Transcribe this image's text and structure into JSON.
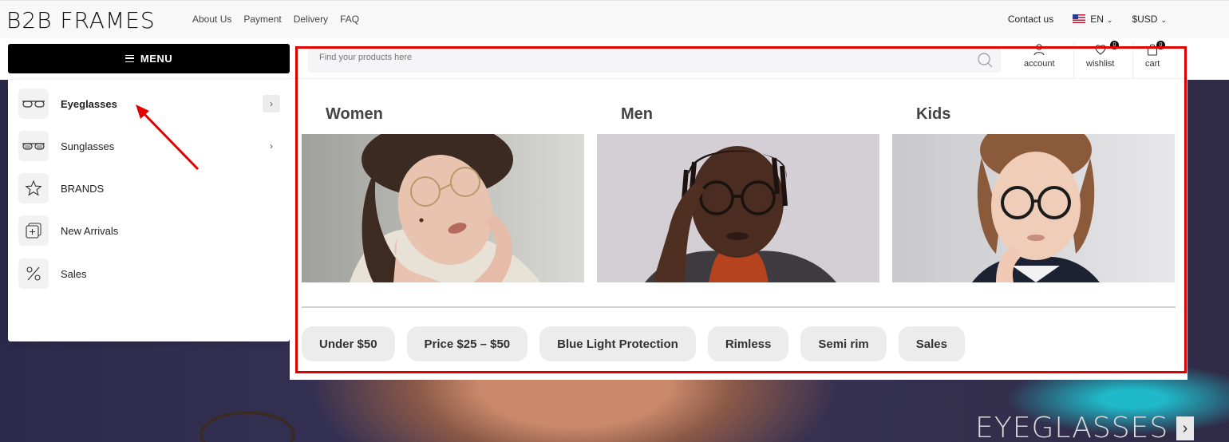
{
  "header": {
    "logo": "B2B FRAMES",
    "nav": [
      "About Us",
      "Payment",
      "Delivery",
      "FAQ"
    ],
    "contact": "Contact us",
    "language": "EN",
    "currency": "$USD"
  },
  "menu_button": {
    "label": "MENU"
  },
  "menu": {
    "items": [
      {
        "label": "Eyeglasses",
        "icon": "eyeglasses-icon",
        "has_submenu": true,
        "active": true
      },
      {
        "label": "Sunglasses",
        "icon": "sunglasses-icon",
        "has_submenu": true,
        "active": false
      },
      {
        "label": "BRANDS",
        "icon": "star-icon",
        "has_submenu": false,
        "active": false
      },
      {
        "label": "New Arrivals",
        "icon": "new-arrivals-icon",
        "has_submenu": false,
        "active": false
      },
      {
        "label": "Sales",
        "icon": "percent-icon",
        "has_submenu": false,
        "active": false
      }
    ]
  },
  "search": {
    "placeholder": "Find your products here"
  },
  "account": {
    "account_label": "account",
    "wishlist_label": "wishlist",
    "wishlist_count": "0",
    "cart_label": "cart",
    "cart_count": "0"
  },
  "categories": [
    {
      "title": "Women"
    },
    {
      "title": "Men"
    },
    {
      "title": "Kids"
    }
  ],
  "filters": [
    "Under $50",
    "Price $25 – $50",
    "Blue Light Protection",
    "Rimless",
    "Semi rim",
    "Sales"
  ],
  "hero": {
    "title": "EYEGLASSES"
  },
  "colors": {
    "accent": "#000000",
    "annotation": "#e00000",
    "chip_bg": "#ececec"
  }
}
